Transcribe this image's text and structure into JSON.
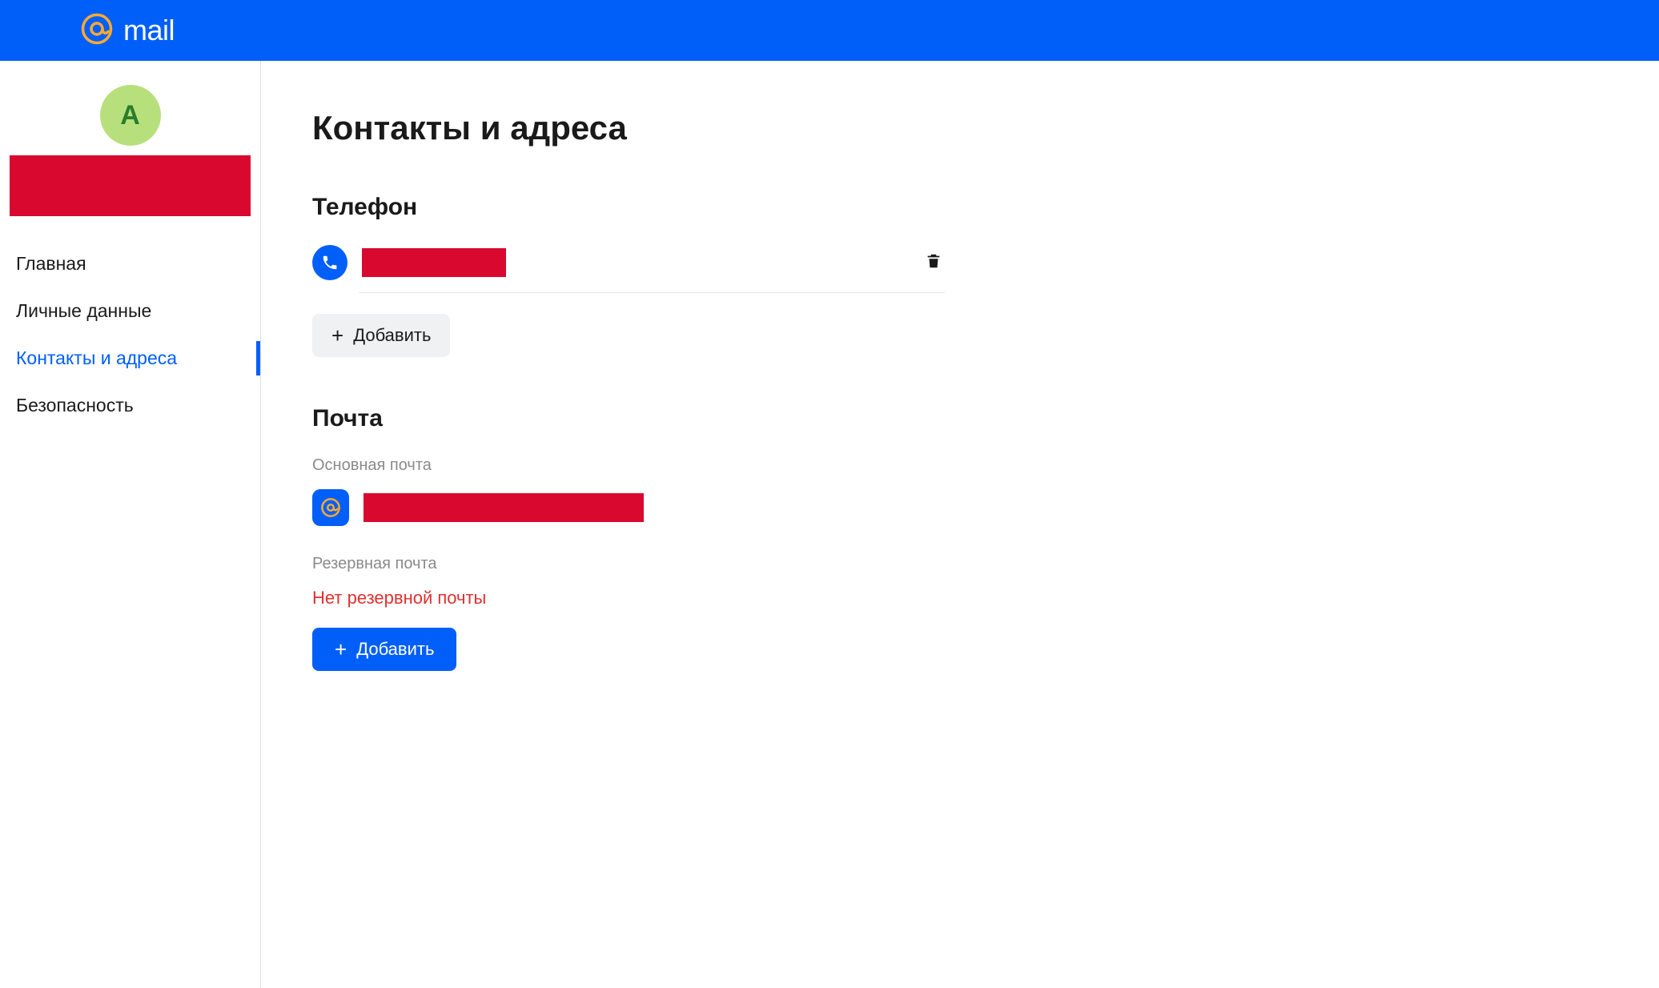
{
  "header": {
    "brand": "mail"
  },
  "sidebar": {
    "avatar_letter": "А",
    "items": [
      {
        "label": "Главная"
      },
      {
        "label": "Личные данные"
      },
      {
        "label": "Контакты и адреса"
      },
      {
        "label": "Безопасность"
      }
    ],
    "active_index": 2
  },
  "main": {
    "title": "Контакты и адреса",
    "phone": {
      "heading": "Телефон",
      "add_label": "Добавить"
    },
    "email": {
      "heading": "Почта",
      "primary_label": "Основная почта",
      "backup_label": "Резервная почта",
      "no_backup_text": "Нет резервной почты",
      "add_label": "Добавить"
    }
  }
}
